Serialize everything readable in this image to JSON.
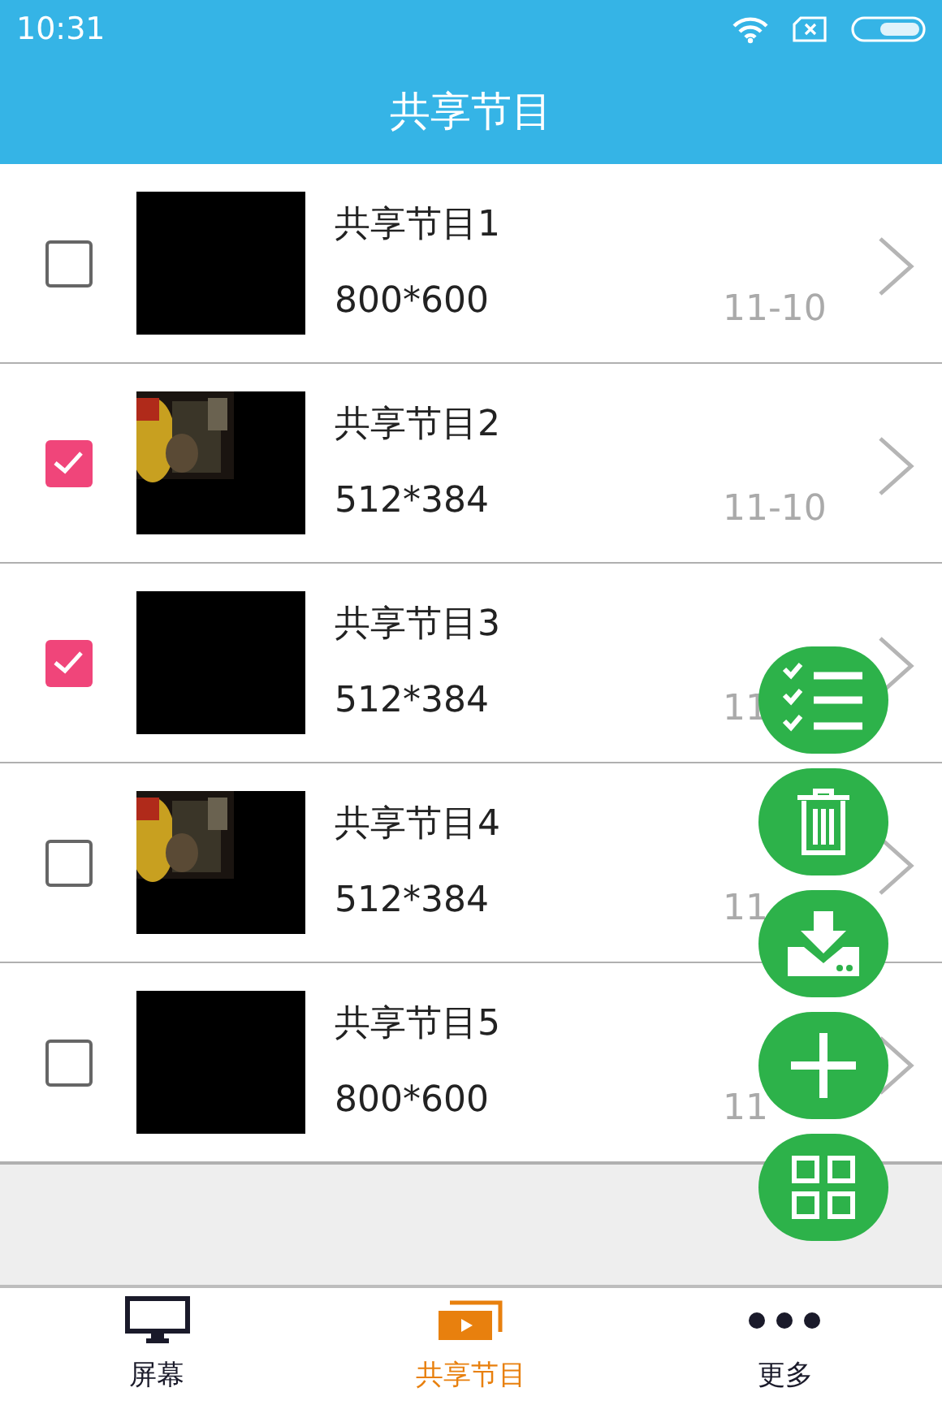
{
  "status_bar": {
    "time": "10:31"
  },
  "header": {
    "title": "共享节目"
  },
  "programs": [
    {
      "title": "共享节目1",
      "resolution": "800*600",
      "date": "11-10",
      "checked": false,
      "kind": "blank"
    },
    {
      "title": "共享节目2",
      "resolution": "512*384",
      "date": "11-10",
      "checked": true,
      "kind": "picture"
    },
    {
      "title": "共享节目3",
      "resolution": "512*384",
      "date": "11",
      "checked": true,
      "kind": "blank"
    },
    {
      "title": "共享节目4",
      "resolution": "512*384",
      "date": "11",
      "checked": false,
      "kind": "picture"
    },
    {
      "title": "共享节目5",
      "resolution": "800*600",
      "date": "11",
      "checked": false,
      "kind": "blank"
    }
  ],
  "fab_actions": [
    {
      "kind": "select"
    },
    {
      "kind": "delete"
    },
    {
      "kind": "download"
    },
    {
      "kind": "add"
    },
    {
      "kind": "grid"
    }
  ],
  "bottom_nav": [
    {
      "label": "屏幕",
      "kind": "screen",
      "selected": false
    },
    {
      "label": "共享节目",
      "kind": "shared",
      "selected": true
    },
    {
      "label": "更多",
      "kind": "more",
      "selected": false
    }
  ]
}
